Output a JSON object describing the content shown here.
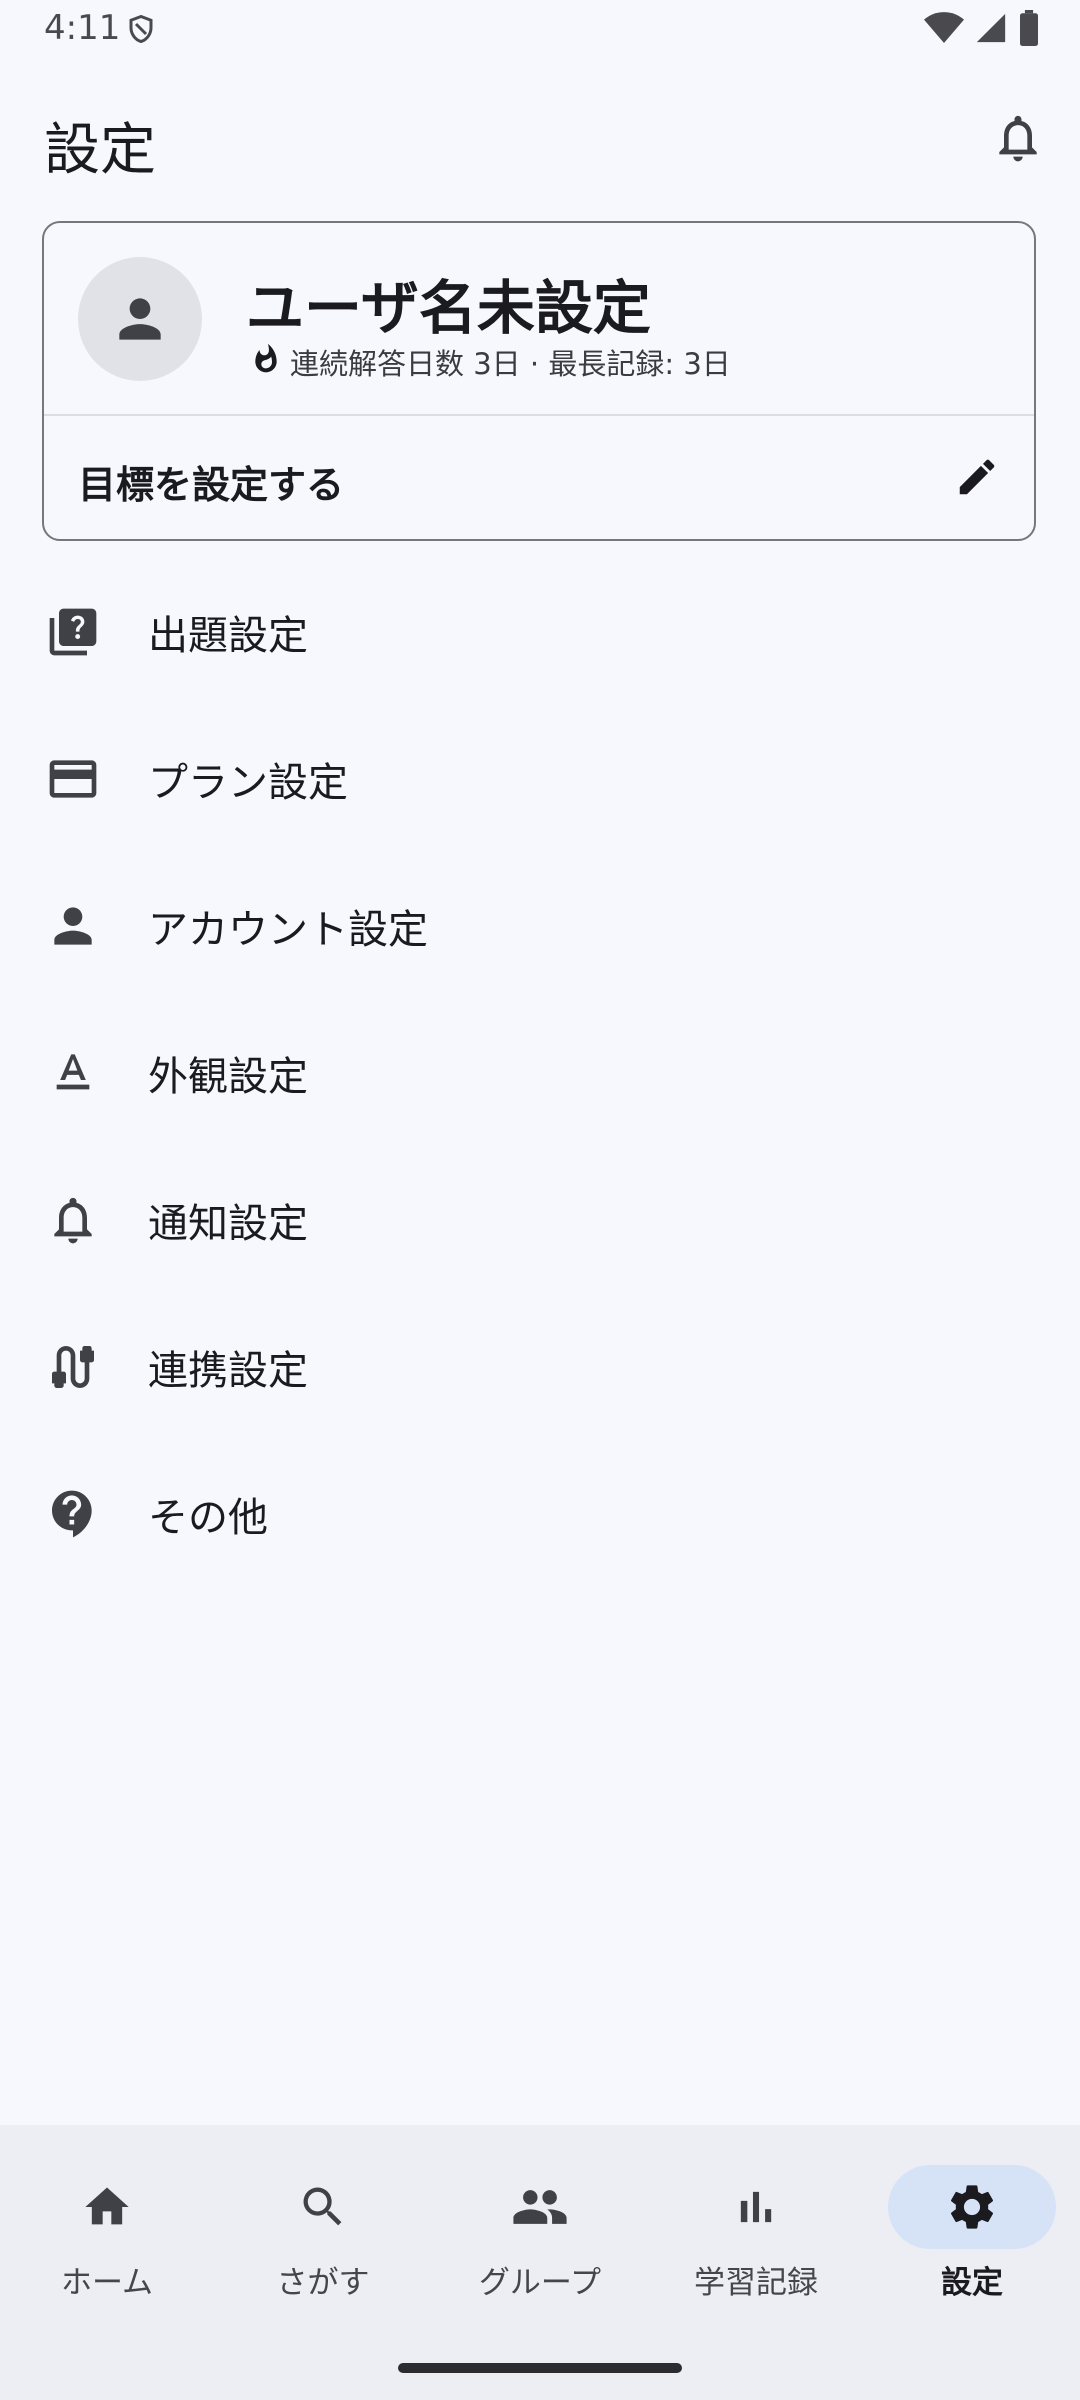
{
  "status_bar": {
    "time": "4:11"
  },
  "header": {
    "title": "設定"
  },
  "profile": {
    "username": "ユーザ名未設定",
    "streak_text": "連続解答日数 3日 · 最長記録: 3日",
    "goal_label": "目標を設定する"
  },
  "menu": {
    "items": [
      {
        "label": "出題設定",
        "icon": "quiz-icon"
      },
      {
        "label": "プラン設定",
        "icon": "credit-card-icon"
      },
      {
        "label": "アカウント設定",
        "icon": "person-icon"
      },
      {
        "label": "外観設定",
        "icon": "text-format-icon"
      },
      {
        "label": "通知設定",
        "icon": "bell-icon"
      },
      {
        "label": "連携設定",
        "icon": "cable-icon"
      },
      {
        "label": "その他",
        "icon": "help-icon"
      }
    ]
  },
  "bottom_nav": {
    "items": [
      {
        "label": "ホーム",
        "icon": "home-icon"
      },
      {
        "label": "さがす",
        "icon": "search-icon"
      },
      {
        "label": "グループ",
        "icon": "group-icon"
      },
      {
        "label": "学習記録",
        "icon": "bar-chart-icon"
      },
      {
        "label": "設定",
        "icon": "gear-icon",
        "active": true
      }
    ]
  },
  "colors": {
    "background": "#f7f8fd",
    "nav_background": "#eceef4",
    "active_pill": "#d6e3f7",
    "icon": "#3f4147"
  }
}
